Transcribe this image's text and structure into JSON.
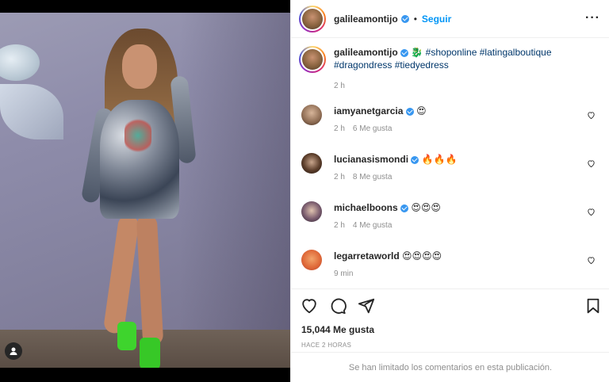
{
  "post": {
    "author": {
      "username": "galileamontijo",
      "verified": true,
      "follow_label": "Seguir",
      "separator": "•"
    },
    "caption": {
      "emoji": "🐉",
      "hashtags": [
        "#shoponline",
        "#latingalboutique",
        "#dragondress",
        "#tiedyedress"
      ],
      "time": "2 h"
    },
    "comments": [
      {
        "username": "iamyanetgarcia",
        "verified": true,
        "text": "😍",
        "time": "2 h",
        "likes": "6 Me gusta"
      },
      {
        "username": "lucianasismondi",
        "verified": true,
        "text": "🔥🔥🔥",
        "time": "2 h",
        "likes": "8 Me gusta"
      },
      {
        "username": "michaelboons",
        "verified": true,
        "text": "😍😍😍",
        "time": "2 h",
        "likes": "4 Me gusta"
      },
      {
        "username": "legarretaworld",
        "verified": false,
        "text": "😍😍😍😍",
        "time": "9 min",
        "likes": ""
      }
    ],
    "likes_count": "15,044 Me gusta",
    "time_ago": "HACE 2 HORAS",
    "comments_limited": "Se han limitado los comentarios en esta publicación."
  },
  "icons": {
    "more": "more-options-icon",
    "like": "heart-icon",
    "comment": "comment-icon",
    "share": "share-icon",
    "save": "bookmark-icon",
    "tag": "user-tag-icon"
  },
  "colors": {
    "link": "#0095f6",
    "hashtag": "#00376b",
    "verified": "#3897f0",
    "muted": "#8e8e8e",
    "text": "#262626"
  }
}
